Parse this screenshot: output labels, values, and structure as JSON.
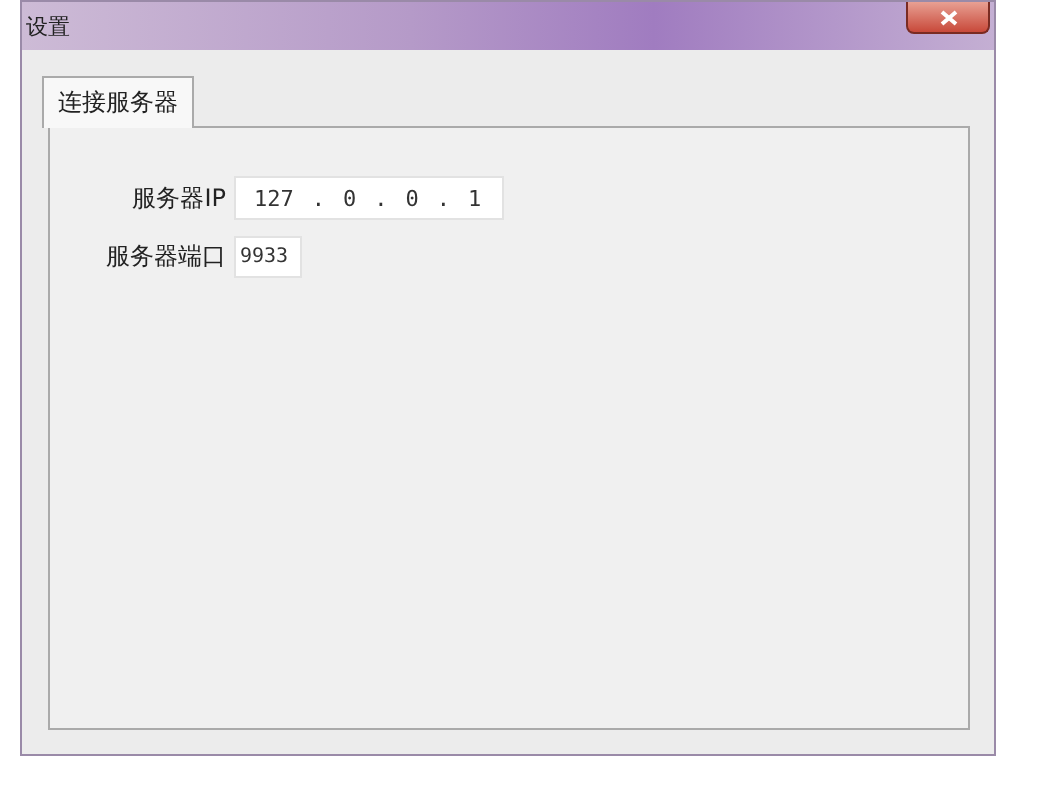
{
  "window": {
    "title": "设置"
  },
  "tabs": [
    {
      "label": "连接服务器",
      "selected": true
    }
  ],
  "fields": [
    {
      "label": "服务器IP",
      "kind": "ip",
      "octets": [
        "127",
        "0",
        "0",
        "1"
      ],
      "separator": "."
    },
    {
      "label": "服务器端口",
      "kind": "text",
      "value": "9933"
    }
  ]
}
